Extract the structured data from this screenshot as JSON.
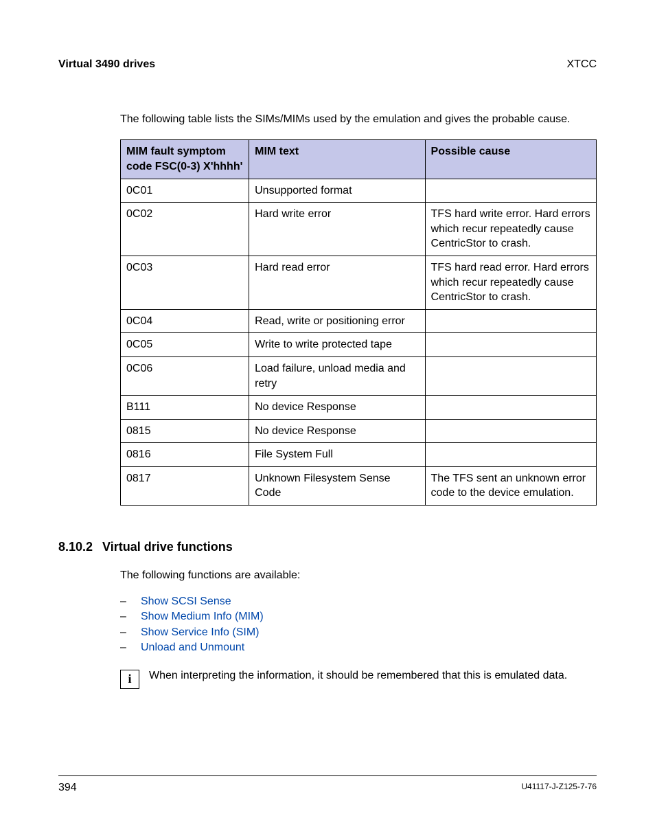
{
  "header": {
    "left": "Virtual 3490 drives",
    "right": "XTCC"
  },
  "intro": "The following table lists the SIMs/MIMs used by the emulation and gives the probable cause.",
  "table": {
    "headers": {
      "col1": "MIM fault symptom code FSC(0-3) X'hhhh'",
      "col2": "MIM text",
      "col3": "Possible cause"
    },
    "rows": [
      {
        "code": "0C01",
        "text": "Unsupported format",
        "cause": ""
      },
      {
        "code": "0C02",
        "text": "Hard write error",
        "cause": "TFS hard write error. Hard errors which recur repeatedly cause CentricStor to crash."
      },
      {
        "code": "0C03",
        "text": "Hard read error",
        "cause": "TFS hard read error. Hard errors which recur repeatedly cause CentricStor to crash."
      },
      {
        "code": "0C04",
        "text": "Read, write or positioning error",
        "cause": ""
      },
      {
        "code": "0C05",
        "text": "Write to write protected tape",
        "cause": ""
      },
      {
        "code": "0C06",
        "text": "Load failure, unload media and retry",
        "cause": ""
      },
      {
        "code": "B111",
        "text": "No device Response",
        "cause": ""
      },
      {
        "code": "0815",
        "text": "No device Response",
        "cause": ""
      },
      {
        "code": "0816",
        "text": "File System Full",
        "cause": ""
      },
      {
        "code": "0817",
        "text": "Unknown Filesystem Sense Code",
        "cause": "The TFS sent an unknown error code to the device emulation."
      }
    ]
  },
  "section": {
    "number": "8.10.2",
    "title": "Virtual drive functions"
  },
  "subtext": "The following functions are available:",
  "links": [
    "Show SCSI Sense",
    "Show Medium Info (MIM)",
    "Show Service Info (SIM)",
    "Unload and Unmount"
  ],
  "info": {
    "glyph": "i",
    "text": "When interpreting the information, it should be remembered that this is emulated data."
  },
  "footer": {
    "page": "394",
    "docid": "U41117-J-Z125-7-76"
  }
}
